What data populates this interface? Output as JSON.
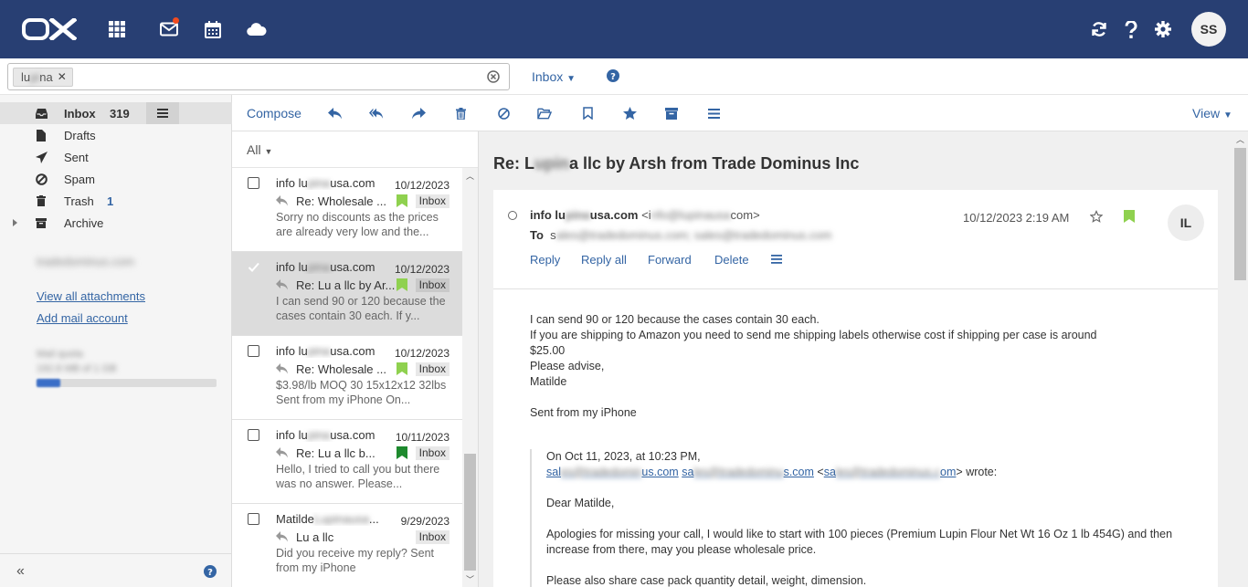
{
  "topbar": {
    "logo_text": "OX",
    "avatar_initials": "SS",
    "icons": [
      "apps-grid-icon",
      "mail-icon",
      "calendar-icon",
      "cloud-drive-icon",
      "refresh-icon",
      "help-icon",
      "settings-gear-icon"
    ]
  },
  "search": {
    "token_visible_start": "lu",
    "token_blurred": "pi",
    "token_visible_end": "na",
    "folder_selector": "Inbox"
  },
  "sidebar": {
    "folders": [
      {
        "label": "Inbox",
        "count": "319",
        "icon": "inbox-icon"
      },
      {
        "label": "Drafts",
        "count": "",
        "icon": "draft-file-icon"
      },
      {
        "label": "Sent",
        "count": "",
        "icon": "sent-plane-icon"
      },
      {
        "label": "Spam",
        "count": "",
        "icon": "spam-ban-icon"
      },
      {
        "label": "Trash",
        "count": "1",
        "icon": "trash-icon"
      },
      {
        "label": "Archive",
        "count": "",
        "icon": "archive-icon"
      }
    ],
    "account_blurred": "tradedominus.com",
    "view_attachments": "View all attachments",
    "add_mail_account": "Add mail account",
    "quota_label_blurred": "Mail quota",
    "quota_value_blurred": "192.8 MB of 1 GB",
    "quota_fraction": 0.13
  },
  "toolbar": {
    "compose": "Compose",
    "view": "View"
  },
  "list": {
    "filter": "All",
    "messages": [
      {
        "from_a": "info lu",
        "from_b": "pina",
        "from_c": "usa.com",
        "date": "10/12/2023",
        "subject": "Re: Wholesale ...",
        "badge": "Inbox",
        "preview": "Sorry no discounts as the prices are already very low and the...",
        "flag": "#8fd14f",
        "selected": false
      },
      {
        "from_a": "info lu",
        "from_b": "pina",
        "from_c": "usa.com",
        "date": "10/12/2023",
        "subject": "Re: Lu    a llc by Ar...",
        "badge": "Inbox",
        "preview": "I can send 90 or 120 because the cases contain 30 each. If y...",
        "flag": "#8fd14f",
        "selected": true
      },
      {
        "from_a": "info lu",
        "from_b": "pina",
        "from_c": "usa.com",
        "date": "10/12/2023",
        "subject": "Re: Wholesale ...",
        "badge": "Inbox",
        "preview": "$3.98/lb MOQ 30 15x12x12 32lbs Sent from my iPhone On...",
        "flag": "#8fd14f",
        "selected": false
      },
      {
        "from_a": "info lu",
        "from_b": "pina",
        "from_c": "usa.com",
        "date": "10/11/2023",
        "subject": "Re: Lu    a llc b...",
        "badge": "Inbox",
        "preview": "Hello, I tried to call you but there was no answer. Please...",
        "flag": "#1e8a2e",
        "selected": false
      },
      {
        "from_a": "Matilde",
        "from_b": "Lupinausa",
        "from_c": "...",
        "date": "9/29/2023",
        "subject": "Lu    a llc",
        "badge": "Inbox",
        "preview": "Did you receive my reply? Sent from my iPhone",
        "flag": "",
        "selected": false
      }
    ]
  },
  "detail": {
    "subject_a": "Re: L",
    "subject_b": "upin",
    "subject_c": "a llc by Arsh from Trade Dominus Inc",
    "from_name_a": "info lu",
    "from_name_b": "pina",
    "from_name_c": "usa.com",
    "from_email_open": "<i",
    "from_email_blurred": "nfo@lupinausa",
    "from_email_close": "com>",
    "to_label": "To",
    "to_prefix": "s",
    "to_blurred": "ales@tradedominus.com; sales@tradedominus.com",
    "date": "10/12/2023 2:19 AM",
    "avatar": "IL",
    "actions": [
      "Reply",
      "Reply all",
      "Forward",
      "Delete"
    ],
    "body": [
      "I can send 90 or 120 because the cases contain 30 each.",
      "If you are shipping to Amazon you need to send me shipping labels otherwise cost if shipping per case is around",
      "$25.00",
      "Please advise,",
      "Matilde",
      "",
      "Sent from my iPhone"
    ],
    "quote_header": "On Oct 11, 2023, at 10:23 PM,",
    "quote_link1_a": "sal",
    "quote_link1_b": "es@tradedomin",
    "quote_link1_c": "us.com",
    "quote_link2_a": "sa",
    "quote_link2_b": "les@tradedominu",
    "quote_link2_c": "s.com",
    "quote_link3_a": "sa",
    "quote_link3_b": "les@tradedominus.c",
    "quote_link3_c": "om",
    "wrote": "> wrote:",
    "greeting": "Dear Matilde,",
    "para1": "Apologies for missing your call, I would like to start with 100 pieces (Premium Lupin Flour Net Wt 16 Oz 1 lb 454G) and then increase from there, may you please wholesale price.",
    "para2": "Please also share case pack quantity detail, weight, dimension."
  }
}
